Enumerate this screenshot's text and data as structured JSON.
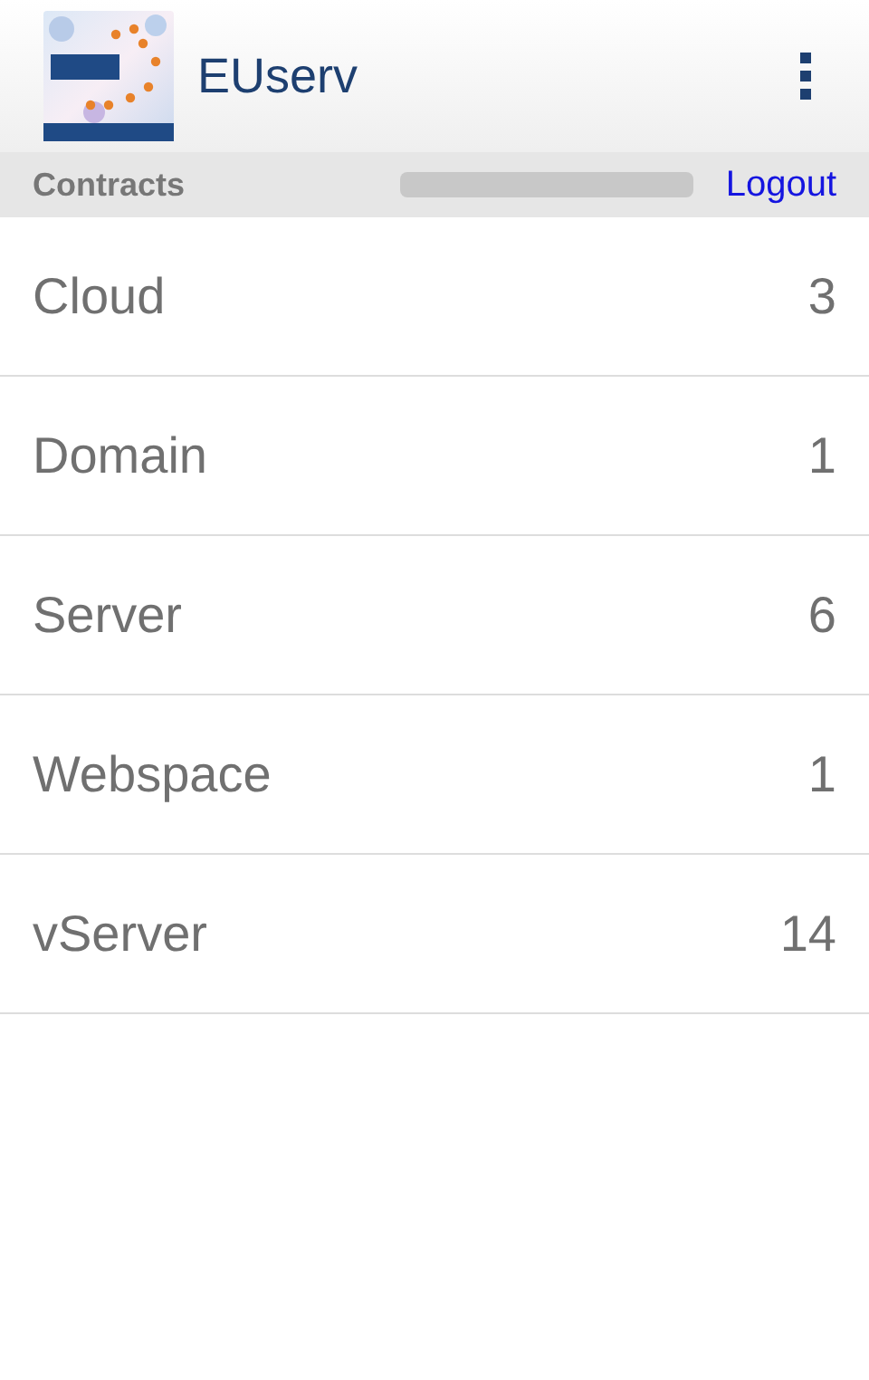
{
  "app_bar": {
    "title": "EUserv"
  },
  "sub_bar": {
    "section": "Contracts",
    "logout": "Logout"
  },
  "contracts": [
    {
      "name": "Cloud",
      "count": "3"
    },
    {
      "name": "Domain",
      "count": "1"
    },
    {
      "name": "Server",
      "count": "6"
    },
    {
      "name": "Webspace",
      "count": "1"
    },
    {
      "name": "vServer",
      "count": "14"
    }
  ]
}
